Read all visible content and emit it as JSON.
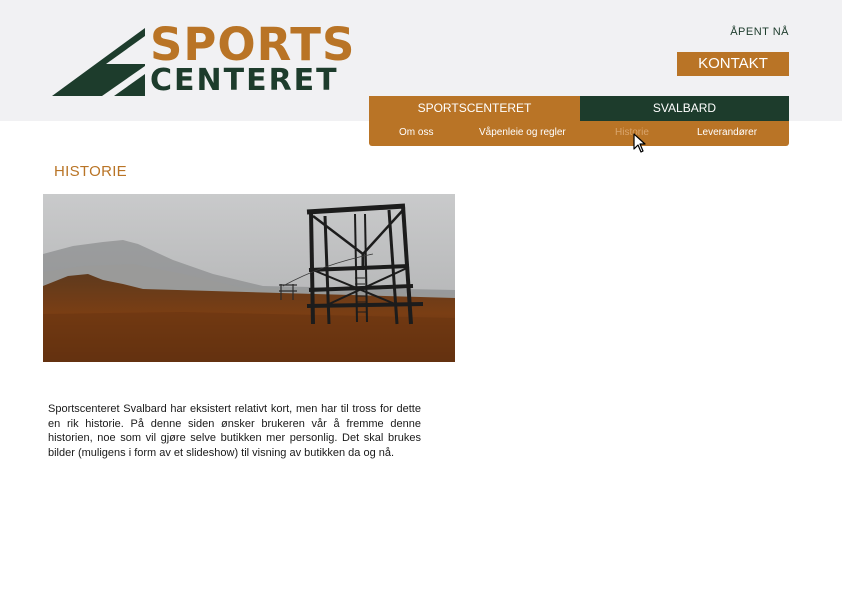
{
  "brand": {
    "line1": "SPORTS",
    "line2": "CENTERET",
    "colors": {
      "brown": "#b97426",
      "green": "#1d3c2c"
    }
  },
  "header": {
    "status": "ÅPENT NÅ",
    "contact_label": "KONTAKT"
  },
  "nav": {
    "tabs": [
      {
        "label": "SPORTSCENTERET"
      },
      {
        "label": "SVALBARD"
      }
    ],
    "subitems": [
      {
        "label": "Om oss"
      },
      {
        "label": "Våpenleie og regler"
      },
      {
        "label": "Historie"
      },
      {
        "label": "Leverandører"
      }
    ]
  },
  "main": {
    "title": "HISTORIE",
    "text": "Sportscenteret Svalbard har eksistert relativt kort, men har til tross for dette en rik historie. På denne siden ønsker brukeren vår å fremme denne historien, noe som vil gjøre selve butikken mer personlig. Det skal brukes bilder (muligens i form av et slideshow) til visning av butikken da og nå."
  },
  "icons": {
    "logo_mark": "mountain-logo-icon",
    "cursor": "mouse-pointer-icon"
  }
}
